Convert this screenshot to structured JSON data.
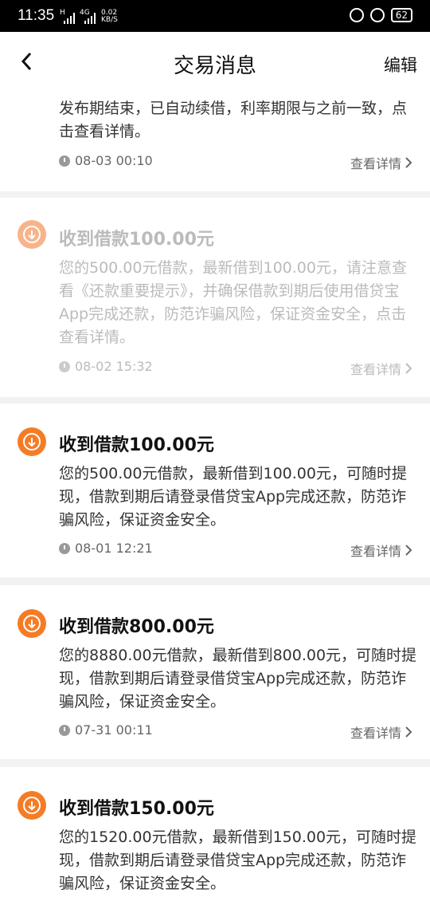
{
  "statusbar": {
    "time": "11:35",
    "net_speed": "0.02",
    "net_unit": "KB/S",
    "battery": "62",
    "signal_labels": [
      "H",
      "4G"
    ]
  },
  "navbar": {
    "title": "交易消息",
    "edit": "编辑"
  },
  "cards": [
    {
      "title": "",
      "body": "发布期结束，已自动续借，利率期限与之前一致，点击查看详情。",
      "time": "08-03 00:10",
      "detail": "查看详情"
    },
    {
      "title": "收到借款100.00元",
      "body": "您的500.00元借款，最新借到100.00元，请注意查看《还款重要提示》，并确保借款到期后使用借贷宝App完成还款，防范诈骗风险，保证资金安全，点击查看详情。",
      "time": "08-02 15:32",
      "detail": "查看详情"
    },
    {
      "title": "收到借款100.00元",
      "body": "您的500.00元借款，最新借到100.00元，可随时提现，借款到期后请登录借贷宝App完成还款，防范诈骗风险，保证资金安全。",
      "time": "08-01 12:21",
      "detail": "查看详情"
    },
    {
      "title": "收到借款800.00元",
      "body": "您的8880.00元借款，最新借到800.00元，可随时提现，借款到期后请登录借贷宝App完成还款，防范诈骗风险，保证资金安全。",
      "time": "07-31 00:11",
      "detail": "查看详情"
    },
    {
      "title": "收到借款150.00元",
      "body": "您的1520.00元借款，最新借到150.00元，可随时提现，借款到期后请登录借贷宝App完成还款，防范诈骗风险，保证资金安全。",
      "time": "",
      "detail": ""
    }
  ],
  "colors": {
    "accent": "#f57c26",
    "accent_faded": "#f7b48a"
  },
  "icons": {
    "back": "chevron-left-icon",
    "download": "download-arrow-icon",
    "clock": "clock-icon",
    "chevron": "chevron-right-icon"
  }
}
